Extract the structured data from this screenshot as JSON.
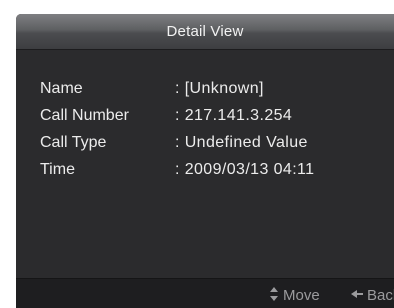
{
  "header": {
    "title": "Detail View"
  },
  "details": [
    {
      "label": "Name",
      "value": ": [Unknown]"
    },
    {
      "label": "Call Number",
      "value": ": 217.141.3.254"
    },
    {
      "label": "Call Type",
      "value": ": Undefined Value"
    },
    {
      "label": "Time",
      "value": ": 2009/03/13 04:11"
    }
  ],
  "footer": {
    "move_label": "Move",
    "move_icon": "up-down-arrows-icon",
    "back_label": "Back",
    "back_icon": "left-arrow-icon"
  },
  "colors": {
    "background": "#2b2b2d",
    "title_bar": "#5e5f62",
    "footer": "#1e1e20",
    "text": "#ececec",
    "hint_text": "#9b9b9d"
  }
}
